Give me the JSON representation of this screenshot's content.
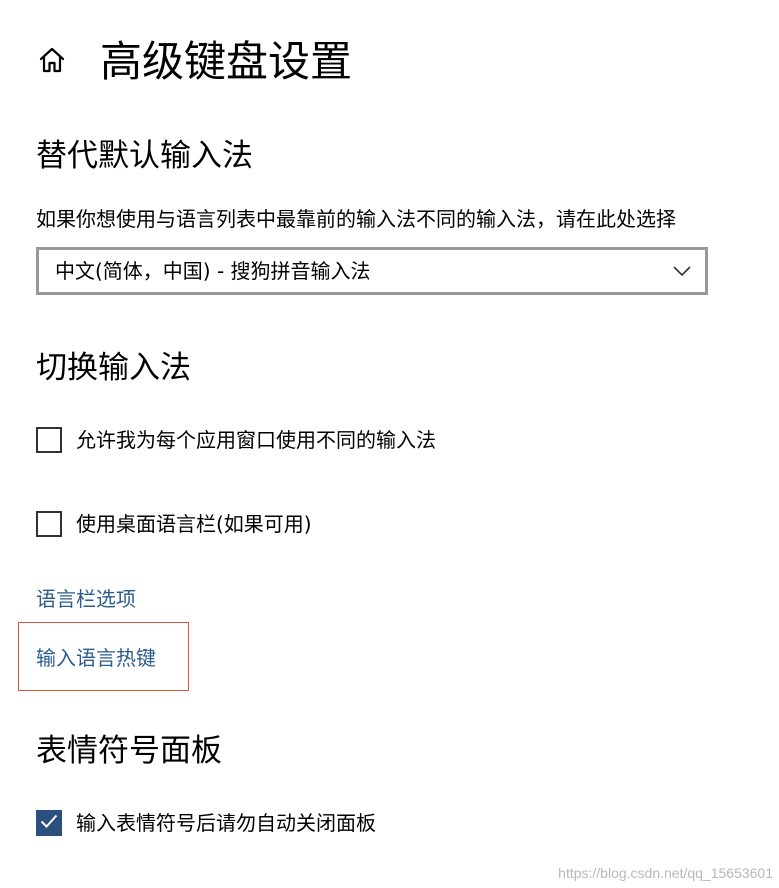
{
  "header": {
    "home_icon": "home-icon",
    "title": "高级键盘设置"
  },
  "default_input": {
    "heading": "替代默认输入法",
    "description": "如果你想使用与语言列表中最靠前的输入法不同的输入法，请在此处选择",
    "dropdown": {
      "selected": "中文(简体，中国) - 搜狗拼音输入法",
      "icon": "chevron-down-icon"
    }
  },
  "switch_input": {
    "heading": "切换输入法",
    "options": [
      {
        "label": "允许我为每个应用窗口使用不同的输入法",
        "checked": false
      },
      {
        "label": "使用桌面语言栏(如果可用)",
        "checked": false
      }
    ],
    "links": {
      "language_bar_options": "语言栏选项",
      "input_language_hotkeys": "输入语言热键"
    }
  },
  "emoji_panel": {
    "heading": "表情符号面板",
    "options": [
      {
        "label": "输入表情符号后请勿自动关闭面板",
        "checked": true
      }
    ]
  },
  "watermark": "https://blog.csdn.net/qq_15653601",
  "colors": {
    "link": "#2b5d8f",
    "checked_box": "#2b4f7e",
    "highlight_border": "#e0513a",
    "dropdown_border": "#999999"
  }
}
